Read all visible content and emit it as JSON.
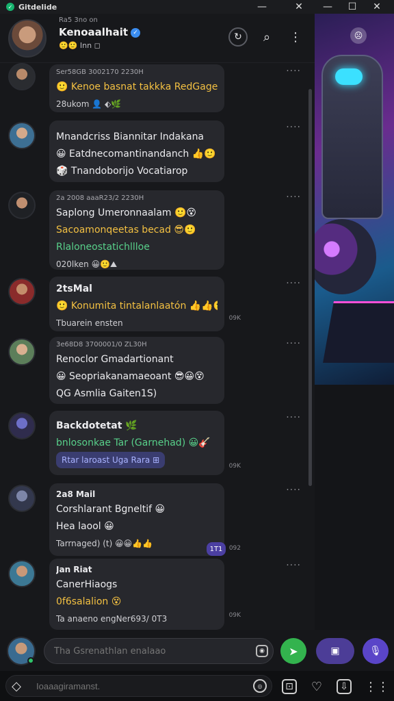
{
  "app": {
    "title": "Gitdelide"
  },
  "window": {
    "minimize": "—",
    "maximize": "☐",
    "close": "✕"
  },
  "header": {
    "meta": "Ra5 3no on",
    "name": "Kenoaalhait",
    "sub": "🙂🙂 Inn ◻",
    "icons": {
      "sync": "↻",
      "search": "⌕",
      "more": "⋮"
    }
  },
  "messages": [
    {
      "meta": "Ser58GB 3002170 2230H",
      "lines": [
        "🙂 Kenoe basnat takkka RedGagelnai",
        "28ukom 👤 ⬖🌿"
      ],
      "dots": "····"
    },
    {
      "meta": "",
      "lines": [
        "Mnandcriss Biannitar Indakana",
        "😀 Eatdnecomantinandanch 👍🙂",
        "🎲 Tnandoborijo Vocatiarop"
      ],
      "dots": "····"
    },
    {
      "meta": "2a 2008 aaaR23/2 2230H",
      "lines": [
        "Saplong Umeronnaalam 🙂😵",
        "Sacoamonqeetas becad 😎🙂",
        "Rlaloneostatichllloe",
        "020lken 😀🙂⛰"
      ],
      "dots": "····"
    },
    {
      "meta": "",
      "lines": [
        "2tsMal",
        "🙂 Konumita tintalanlaatón 👍👍🙂",
        "Tbuarein ensten"
      ],
      "dots": "····",
      "ts": "09K"
    },
    {
      "meta": "3e68D8 3700001/0 ZL30H",
      "lines": [
        "Renoclor Gmadartionant",
        "😀 Seopriakanamaeoant 😎😀😵",
        "QG Asmlia Gaiten1S)"
      ],
      "dots": "····"
    },
    {
      "meta": "",
      "lines": [
        "Backdotetat 🌿",
        "bnlosonkae Tar (Garnehad) 😀🎸"
      ],
      "chip": "Rtar laroast Uga Rara ⊞",
      "dots": "····",
      "ts": "09K"
    },
    {
      "meta": "",
      "lines": [
        "2a8 Mail",
        "Corshlarant Bgneltif 😀",
        "Hea laool 😀",
        "Tarrnaged) (t) 😀😀👍👍"
      ],
      "pill": "1T1",
      "dots": "····",
      "ts": "092"
    },
    {
      "meta": "",
      "lines": [
        "Jan Riat",
        "CanerHiaogs",
        "0f6salalion 😵",
        "Ta anaeno engNer693/ 0T3"
      ],
      "dots": "····",
      "ts": "09K"
    }
  ],
  "compose": {
    "placeholder": "Tha Gsrenathlan enalaao",
    "send_icon": "➤",
    "media_icon": "▣",
    "mic_icon": "🎙",
    "cam_icon": "◉"
  },
  "bottom": {
    "search_placeholder": "Ioaaagiramanst.",
    "icons": [
      "◎",
      "⊡",
      "♡",
      "⇩",
      "⋮⋮"
    ]
  },
  "side_art": {
    "badge": "☹"
  }
}
